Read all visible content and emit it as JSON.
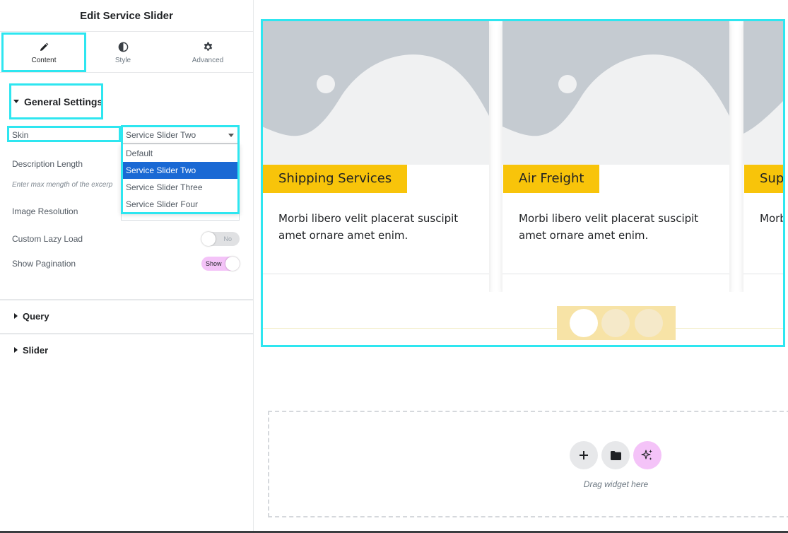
{
  "panel": {
    "title": "Edit Service Slider",
    "tabs": [
      {
        "label": "Content",
        "icon": "pencil-icon"
      },
      {
        "label": "Style",
        "icon": "half-circle-icon"
      },
      {
        "label": "Advanced",
        "icon": "gear-icon"
      }
    ],
    "sections": {
      "general": "General Settings",
      "query": "Query",
      "slider": "Slider"
    },
    "controls": {
      "skin_label": "Skin",
      "skin_value": "Service Slider Two",
      "skin_options": [
        "Default",
        "Service Slider Two",
        "Service Slider Three",
        "Service Slider Four"
      ],
      "description_length_label": "Description Length",
      "description_length_hint": "Enter max mength of the excerp",
      "image_resolution_label": "Image Resolution",
      "custom_lazy_load_label": "Custom Lazy Load",
      "custom_lazy_load_state": "No",
      "show_pagination_label": "Show Pagination",
      "show_pagination_state": "Show"
    }
  },
  "preview": {
    "cards": [
      {
        "title": "Shipping Services",
        "description": "Morbi libero velit placerat suscipit amet ornare amet enim."
      },
      {
        "title": "Air Freight",
        "description": "Morbi libero velit placerat suscipit amet ornare amet enim."
      },
      {
        "title": "Supp",
        "description": "Morbi amet"
      }
    ],
    "pagination_dots": 3,
    "active_dot": 1,
    "dropzone_text": "Drag widget here"
  },
  "colors": {
    "accent_yellow": "#f8c40a",
    "highlight_cyan": "#2ee6f0",
    "selected_option": "#1a69d4",
    "toggle_on": "#f4c3f8"
  }
}
